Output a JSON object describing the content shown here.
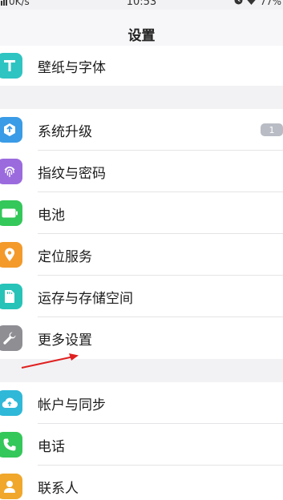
{
  "status_bar": {
    "speed": "0K/s",
    "time": "10:53",
    "battery": "77%",
    "icons": [
      "signal-icon",
      "alarm-icon",
      "wifi-icon"
    ]
  },
  "navbar": {
    "title": "设置"
  },
  "groups": [
    {
      "items": [
        {
          "label": "壁纸与字体",
          "icon": "font-icon",
          "color": "#2ec4c2"
        }
      ]
    },
    {
      "items": [
        {
          "label": "系统升级",
          "icon": "system-update-icon",
          "color": "#3a9be6",
          "badge": "1"
        },
        {
          "label": "指纹与密码",
          "icon": "fingerprint-icon",
          "color": "#9b6bde"
        },
        {
          "label": "电池",
          "icon": "battery-icon",
          "color": "#34c759"
        },
        {
          "label": "定位服务",
          "icon": "location-icon",
          "color": "#f39a2b"
        },
        {
          "label": "运存与存储空间",
          "icon": "storage-icon",
          "color": "#27c3b8"
        },
        {
          "label": "更多设置",
          "icon": "wrench-icon",
          "color": "#8e8e93"
        }
      ]
    },
    {
      "items": [
        {
          "label": "帐户与同步",
          "icon": "cloud-sync-icon",
          "color": "#2fb8d8"
        },
        {
          "label": "电话",
          "icon": "phone-icon",
          "color": "#34c759"
        },
        {
          "label": "联系人",
          "icon": "contacts-icon",
          "color": "#f0a72b"
        }
      ]
    }
  ],
  "annotation": {
    "icon": "red-arrow-icon",
    "color": "#e02020"
  }
}
